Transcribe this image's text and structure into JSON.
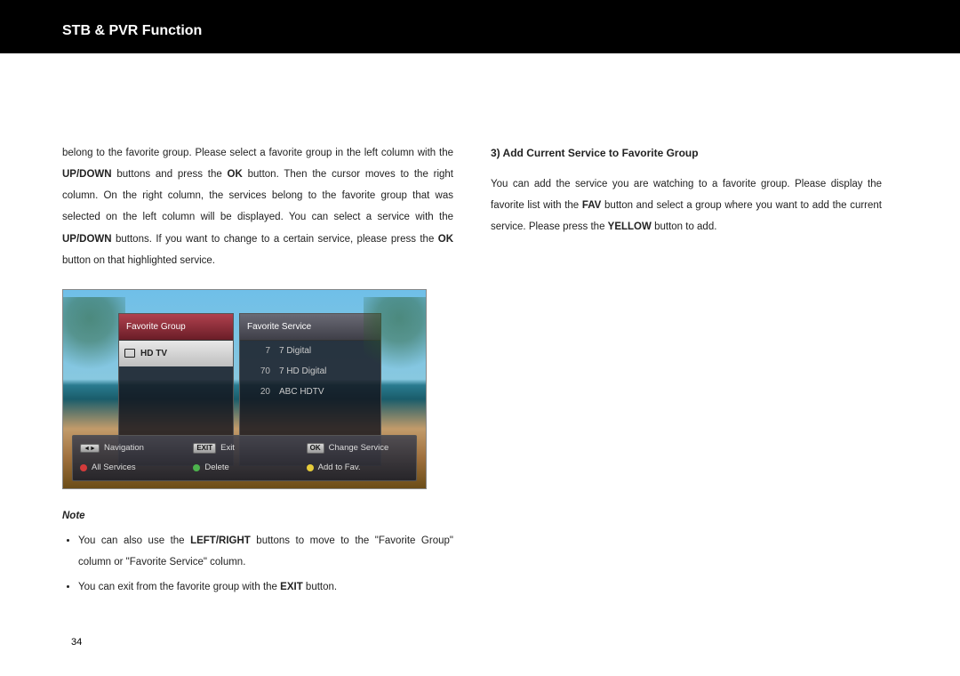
{
  "header": {
    "title": "STB & PVR Function"
  },
  "left": {
    "para": [
      "belong to the favorite group. Please select a favorite group in the left column with the ",
      "UP/DOWN",
      " buttons and press the ",
      "OK",
      " button. Then the cursor moves to the right column. On the right column, the services belong to the favorite group that was selected on the left column will be displayed. You can select a service with the ",
      "UP/DOWN",
      " buttons. If you want to change to a certain service, please press the ",
      "OK",
      " button on that highlighted service."
    ],
    "noteLabel": "Note",
    "notes": {
      "n1a": "You can also use the ",
      "n1b": "LEFT/RIGHT",
      "n1c": " buttons to move to the \"Favorite Group\" column or \"Favorite Service\" column.",
      "n2a": "You can exit from the favorite group with the ",
      "n2b": "EXIT",
      "n2c": " button."
    }
  },
  "tv": {
    "leftHeader": "Favorite Group",
    "rightHeader": "Favorite Service",
    "group": "HD TV",
    "services": [
      {
        "num": "7",
        "name": "7 Digital"
      },
      {
        "num": "70",
        "name": "7 HD Digital"
      },
      {
        "num": "20",
        "name": "ABC HDTV"
      }
    ],
    "hints": {
      "nav": "Navigation",
      "allServices": "All Services",
      "exitKey": "EXIT",
      "exit": "Exit",
      "delete": "Delete",
      "okKey": "OK",
      "change": "Change Service",
      "addFav": "Add to Fav."
    }
  },
  "right": {
    "heading": "3) Add Current Service to Favorite Group",
    "p": [
      "You can add the service you are watching to a favorite group. Please display the favorite list with the ",
      "FAV",
      " button and select a group where you want to add the current service. Please press the ",
      "YELLOW",
      " button to add."
    ]
  },
  "pageNumber": "34"
}
